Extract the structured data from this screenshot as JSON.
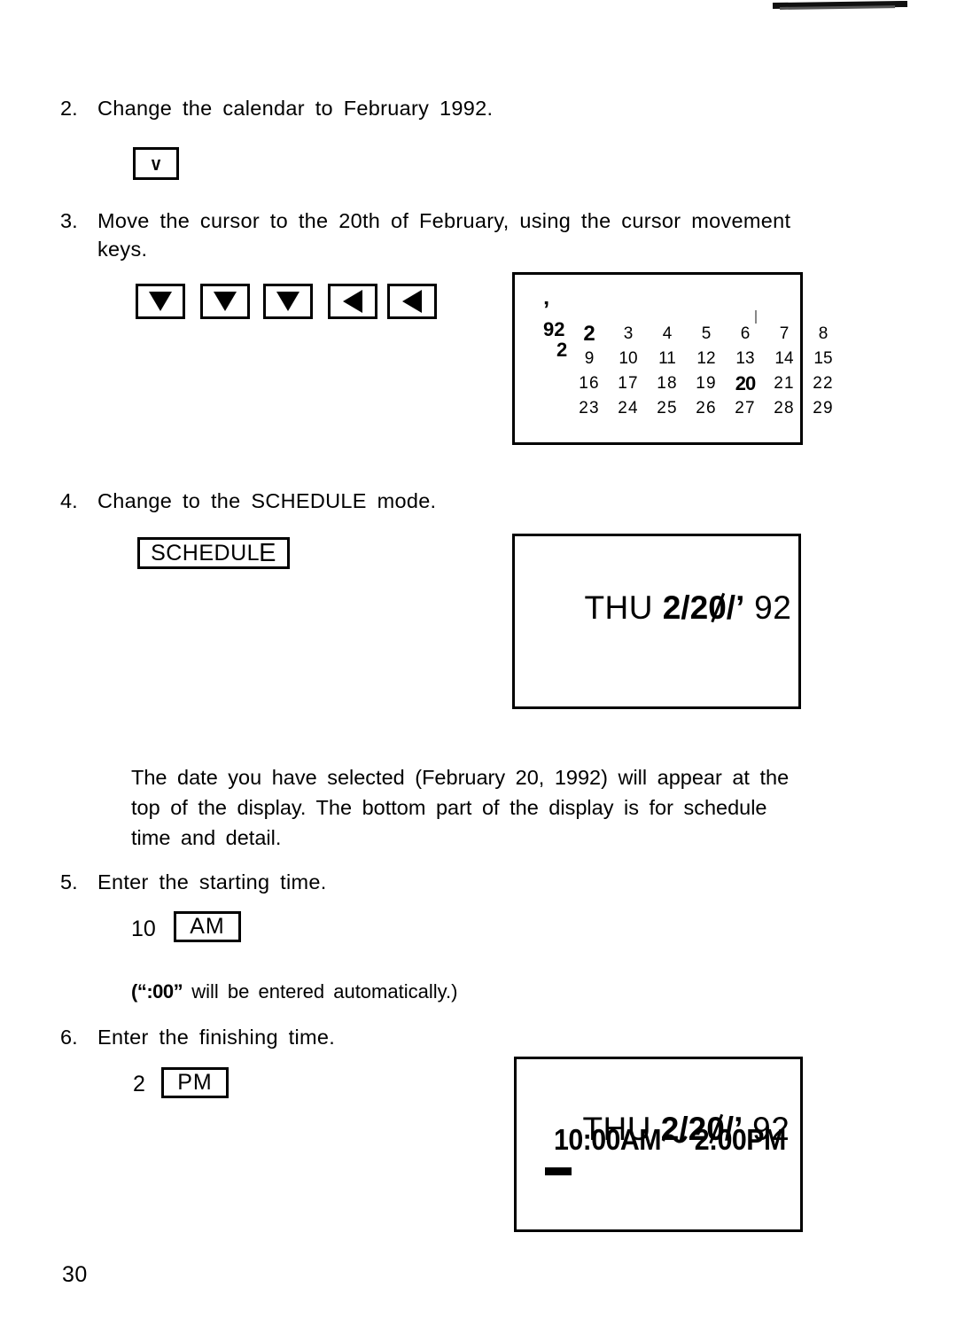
{
  "page": {
    "number": "30"
  },
  "steps": {
    "two": {
      "number": "2.",
      "text": "Change  the  calendar  to  February  1992.",
      "key": {
        "name": "down-marker-key",
        "glyph": "v"
      }
    },
    "three": {
      "number": "3.",
      "line1": "Move  the  cursor  to  the  20th  of  February,  using  the  cursor  movement",
      "line2": "keys.",
      "keys": [
        {
          "name": "cursor-down-key-1",
          "direction": "down"
        },
        {
          "name": "cursor-down-key-2",
          "direction": "down"
        },
        {
          "name": "cursor-down-key-3",
          "direction": "down"
        },
        {
          "name": "cursor-left-key-1",
          "direction": "left"
        },
        {
          "name": "cursor-left-key-2",
          "direction": "left"
        }
      ]
    },
    "four": {
      "number": "4.",
      "text": "Change  to  the  SCHEDULE  mode.",
      "key": {
        "name": "schedule-key",
        "label_main": "SCHEDUL",
        "label_tail": "E"
      }
    },
    "five": {
      "number": "5.",
      "text": "Enter  the  starting  time.",
      "input_number": "10",
      "key": {
        "name": "am-key",
        "label": "AM"
      },
      "note": "will  be  entered  automatically.)",
      "note_prefix": "(“:00”"
    },
    "six": {
      "number": "6.",
      "text": "Enter  the  finishing  time.",
      "input_number": "2",
      "key": {
        "name": "pm-key",
        "label": "PM"
      }
    }
  },
  "paragraph": {
    "line1": "The  date  you  have  selected  (February  20,  1992)  will  appear  at  the",
    "line2": "top  of  the  display.  The  bottom  part  of  the  display  is  for  schedule",
    "line3": "time and detail."
  },
  "calendar_display": {
    "name": "calendar-lcd",
    "year_apostrophe": "’",
    "year": "92",
    "month": "2",
    "weeks": [
      [
        "2",
        "3",
        "4",
        "5",
        "6",
        "7",
        "8"
      ],
      [
        "9",
        "10",
        "11",
        "12",
        "13",
        "14",
        "15"
      ],
      [
        "16",
        "17",
        "18",
        "19",
        "20",
        "21",
        "22"
      ],
      [
        "23",
        "24",
        "25",
        "26",
        "27",
        "28",
        "29"
      ]
    ],
    "selected_day": "20"
  },
  "schedule_display_top": {
    "name": "schedule-lcd-date-only",
    "weekday": "THU",
    "month": "2",
    "separator1": "/",
    "day_tens": "2",
    "day_zero": "0",
    "separator2": "/",
    "year_apostrophe": "’",
    "year": "92"
  },
  "schedule_display_full": {
    "name": "schedule-lcd-with-times",
    "weekday": "THU",
    "month": "2",
    "separator1": "/",
    "day_tens": "2",
    "day_zero": "0",
    "separator2": "/",
    "year_apostrophe": "’",
    "year": "92",
    "time_line": "10:00AM～ 2:00PM"
  },
  "colors": {
    "ink": "#000000",
    "paper": "#ffffff"
  }
}
